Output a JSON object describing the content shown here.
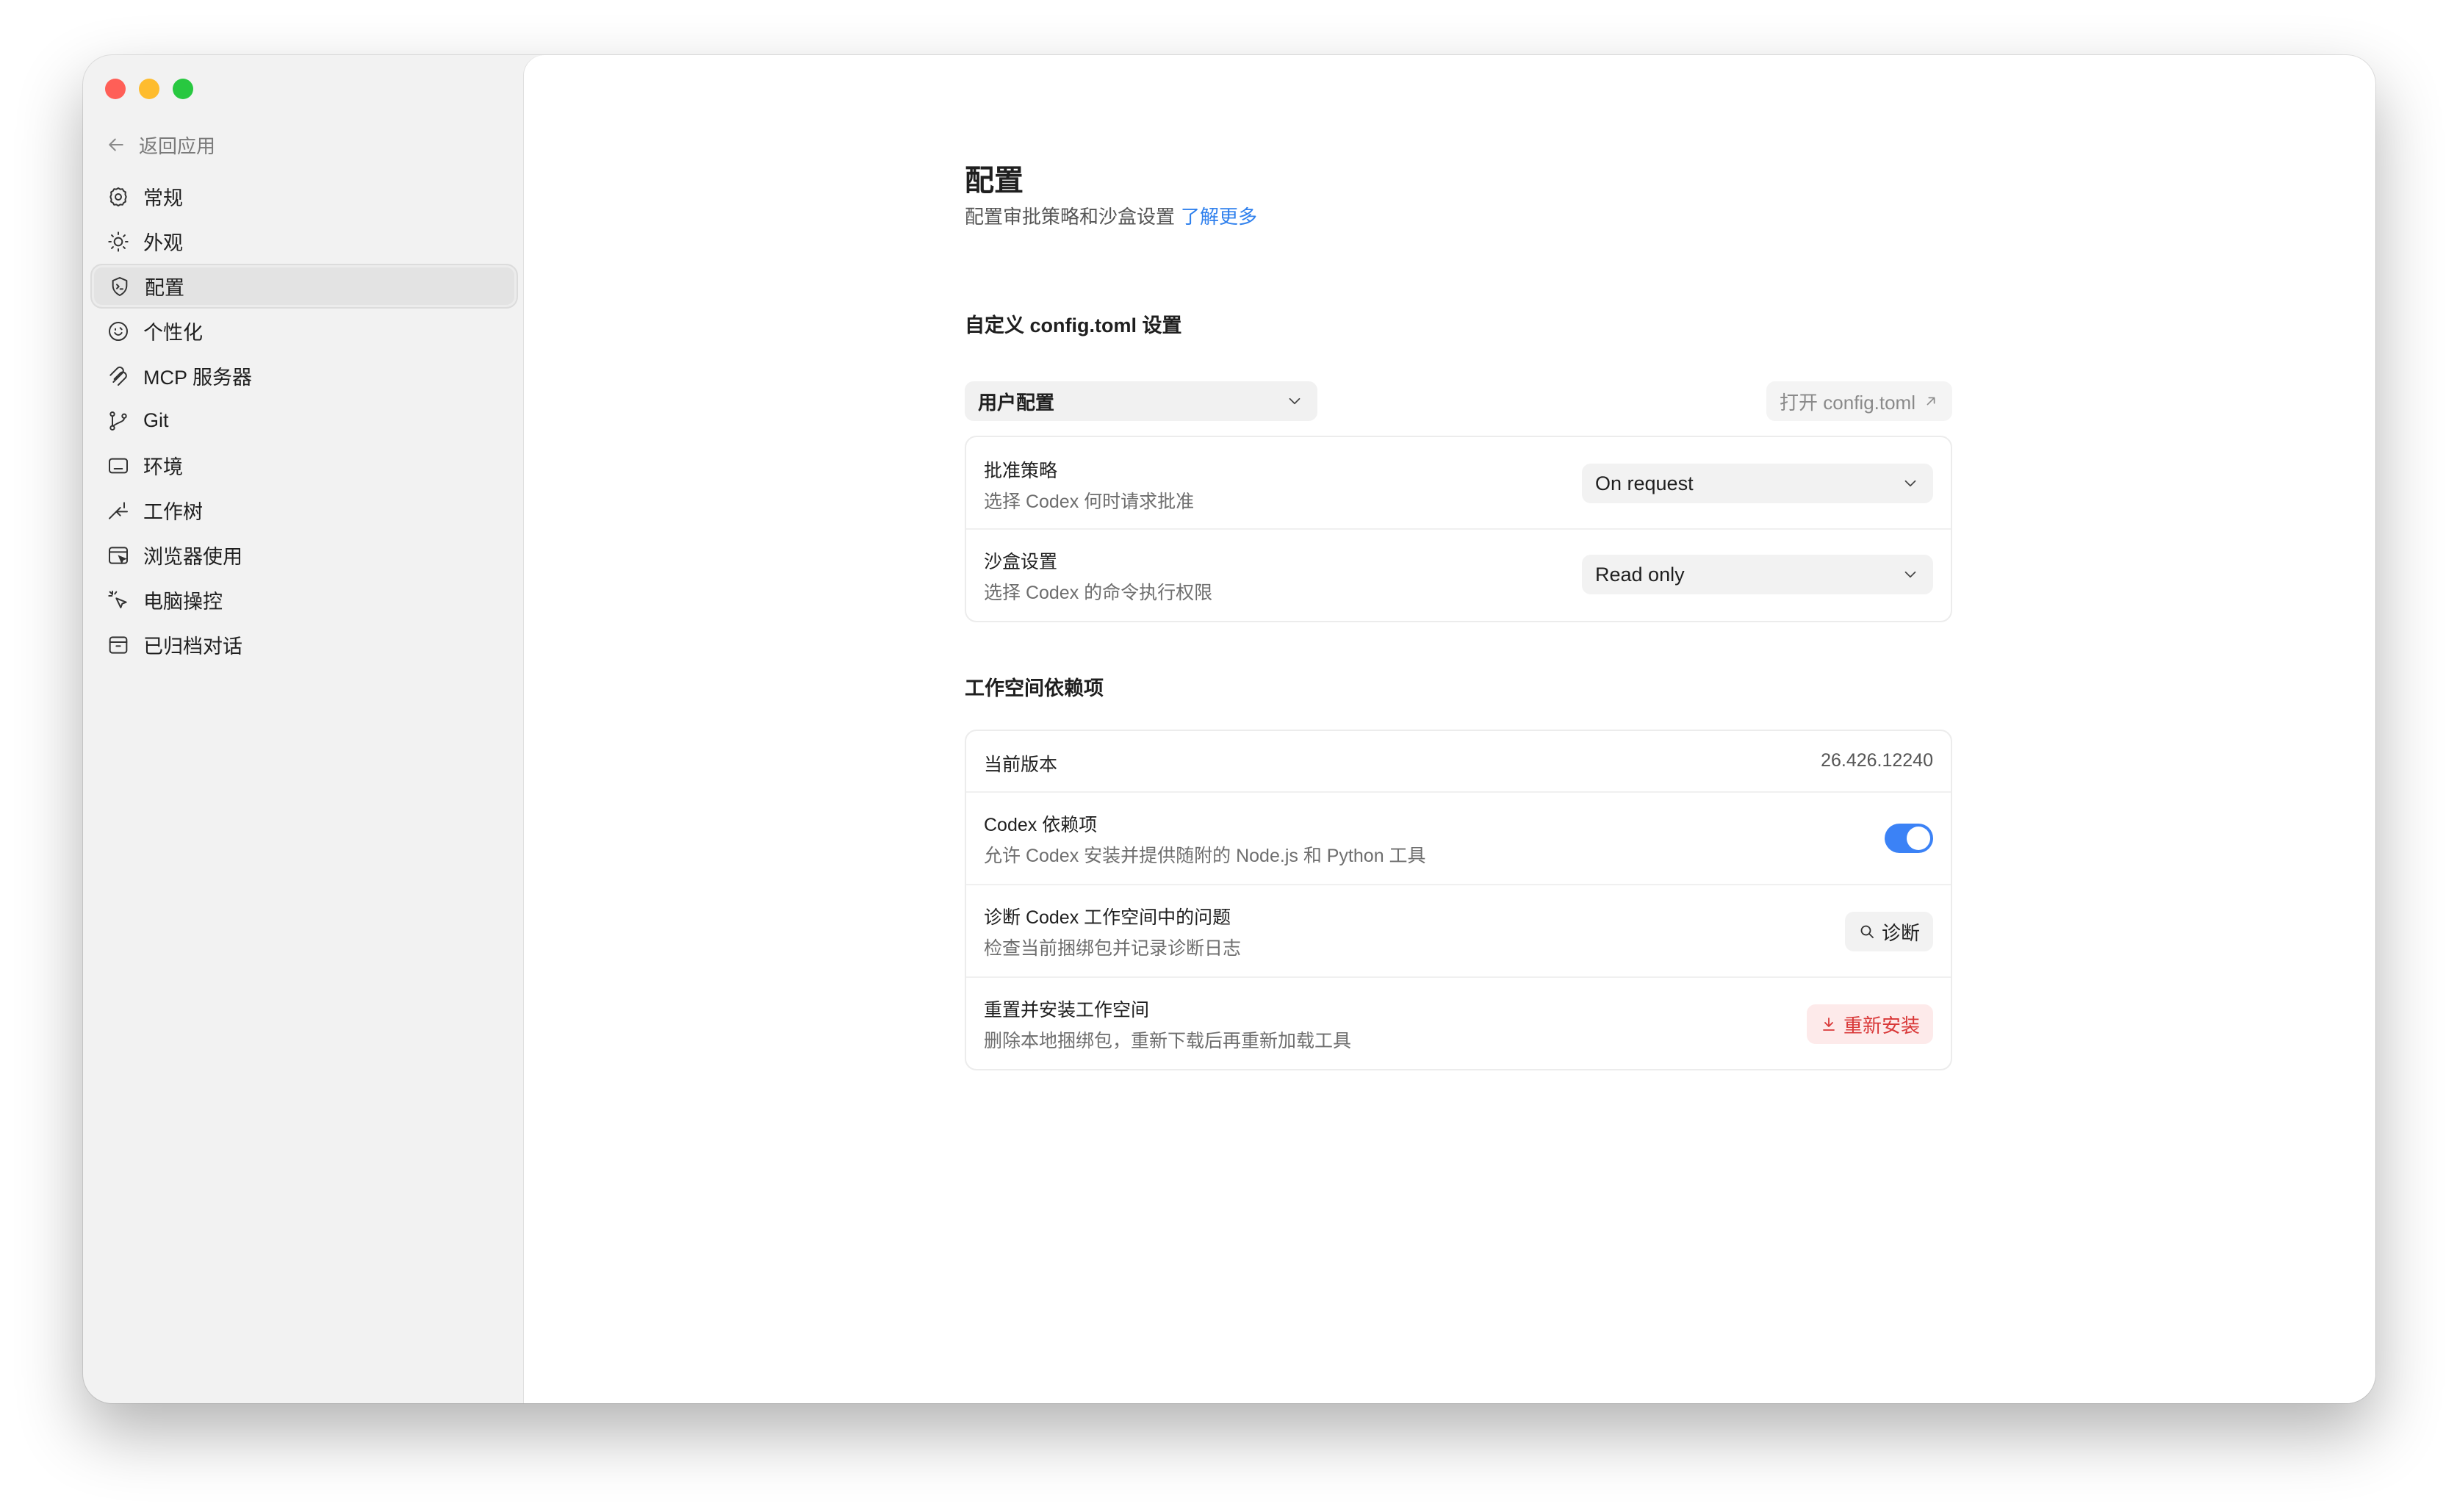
{
  "sidebar": {
    "back_label": "返回应用",
    "items": [
      {
        "label": "常规",
        "icon": "gear-icon"
      },
      {
        "label": "外观",
        "icon": "sun-icon"
      },
      {
        "label": "配置",
        "icon": "shield-icon",
        "active": true
      },
      {
        "label": "个性化",
        "icon": "smile-icon"
      },
      {
        "label": "MCP 服务器",
        "icon": "mcp-icon"
      },
      {
        "label": "Git",
        "icon": "git-branch-icon"
      },
      {
        "label": "环境",
        "icon": "terminal-icon"
      },
      {
        "label": "工作树",
        "icon": "worktree-icon"
      },
      {
        "label": "浏览器使用",
        "icon": "browser-icon"
      },
      {
        "label": "电脑操控",
        "icon": "cursor-click-icon"
      },
      {
        "label": "已归档对话",
        "icon": "archive-icon"
      }
    ]
  },
  "page": {
    "title": "配置",
    "subtitle": "配置审批策略和沙盒设置",
    "learn_more": "了解更多"
  },
  "config_section": {
    "heading": "自定义 config.toml 设置",
    "scope_select": "用户配置",
    "open_button": "打开 config.toml",
    "rows": [
      {
        "title": "批准策略",
        "desc": "选择 Codex 何时请求批准",
        "value": "On request"
      },
      {
        "title": "沙盒设置",
        "desc": "选择 Codex 的命令执行权限",
        "value": "Read only"
      }
    ]
  },
  "workspace_section": {
    "heading": "工作空间依赖项",
    "version_label": "当前版本",
    "version_value": "26.426.12240",
    "deps_title": "Codex 依赖项",
    "deps_desc": "允许 Codex 安装并提供随附的 Node.js 和 Python 工具",
    "deps_enabled": true,
    "diag_title": "诊断 Codex 工作空间中的问题",
    "diag_desc": "检查当前捆绑包并记录诊断日志",
    "diag_button": "诊断",
    "reset_title": "重置并安装工作空间",
    "reset_desc": "删除本地捆绑包，重新下载后再重新加载工具",
    "reset_button": "重新安装"
  },
  "colors": {
    "accent": "#3b82f6",
    "link": "#2f80ed",
    "danger": "#d93838",
    "danger_bg": "#fdeaea"
  }
}
